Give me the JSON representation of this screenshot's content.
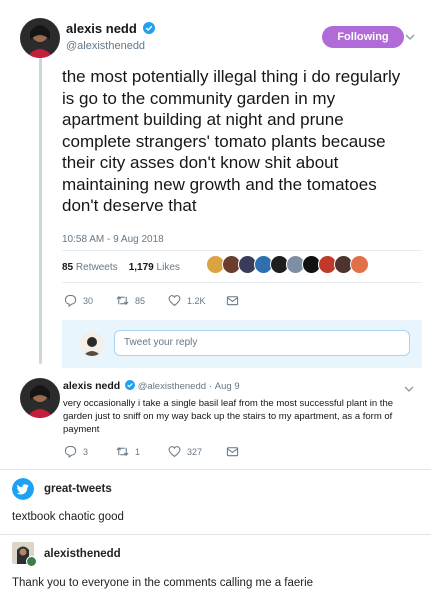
{
  "tweet": {
    "author_name": "alexis nedd",
    "author_handle": "@alexisthenedd",
    "follow_label": "Following",
    "text": "the most potentially illegal thing i do regularly is go to the community garden in my apartment building at night and prune complete strangers' tomato plants because their city asses don't know shit about maintaining new growth and the tomatoes don't deserve that",
    "timestamp": "10:58 AM - 9 Aug 2018",
    "retweets_count": "85",
    "retweets_label": "Retweets",
    "likes_count": "1,179",
    "likes_label": "Likes",
    "actions": {
      "replies": "30",
      "retweets": "85",
      "likes": "1.2K"
    },
    "reply_placeholder": "Tweet your reply",
    "colors": {
      "follow_button": "#b06bd9",
      "verified": "#1da1f2",
      "thread_line": "#ccd6dd"
    }
  },
  "reply_tweet": {
    "author_name": "alexis nedd",
    "author_handle": "@alexisthenedd",
    "separator": "·",
    "date": "Aug 9",
    "text": "very occasionally i take a single basil leaf from the most successful plant in the garden just to sniff on my way back up the stairs to my apartment, as a form of payment",
    "actions": {
      "replies": "3",
      "retweets": "1",
      "likes": "327"
    }
  },
  "posts": [
    {
      "author": "great-tweets",
      "body": "textbook chaotic good",
      "avatar_icon": "twitter-bird-icon",
      "avatar_color": "#1da1f2"
    },
    {
      "author": "alexisthenedd",
      "body": "Thank you to everyone in the comments calling me a faerie",
      "avatar_icon": "user-avatar",
      "avatar_color": "#3a7d4f"
    }
  ]
}
